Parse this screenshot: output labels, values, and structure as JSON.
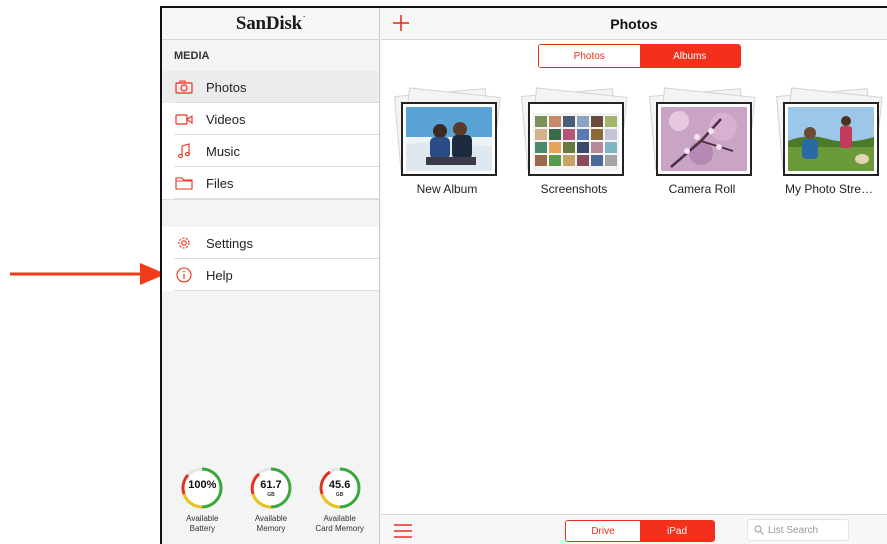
{
  "sidebar": {
    "logo": "SanDisk",
    "logo_mark": "·",
    "section_label": "MEDIA",
    "media_items": [
      {
        "label": "Photos",
        "icon": "camera-icon"
      },
      {
        "label": "Videos",
        "icon": "video-camera-icon"
      },
      {
        "label": "Music",
        "icon": "music-note-icon"
      },
      {
        "label": "Files",
        "icon": "folder-icon"
      }
    ],
    "other_items": [
      {
        "label": "Settings",
        "icon": "gear-icon"
      },
      {
        "label": "Help",
        "icon": "info-icon"
      }
    ],
    "gauges": [
      {
        "value": "100%",
        "unit": "",
        "label_line1": "Available",
        "label_line2": "Battery",
        "level": 1.0
      },
      {
        "value": "61.7",
        "unit": "GB",
        "label_line1": "Available",
        "label_line2": "Memory",
        "level": 0.85
      },
      {
        "value": "45.6",
        "unit": "GB",
        "label_line1": "Available",
        "label_line2": "Card Memory",
        "level": 0.75
      }
    ]
  },
  "main": {
    "title": "Photos",
    "view_toggle": {
      "left": "Photos",
      "right": "Albums",
      "selected": "Albums"
    },
    "albums": [
      {
        "name": "New Album"
      },
      {
        "name": "Screenshots"
      },
      {
        "name": "Camera Roll"
      },
      {
        "name": "My Photo Stre…"
      }
    ],
    "source_toggle": {
      "left": "Drive",
      "right": "iPad",
      "selected": "iPad"
    },
    "search": {
      "placeholder": "List Search",
      "value": ""
    }
  },
  "colors": {
    "accent": "#f2301b",
    "annotation_arrow": "#f03c1a",
    "gauge_green": "#3aa83a",
    "gauge_yellow": "#e8c21a",
    "gauge_red": "#e0341c"
  }
}
